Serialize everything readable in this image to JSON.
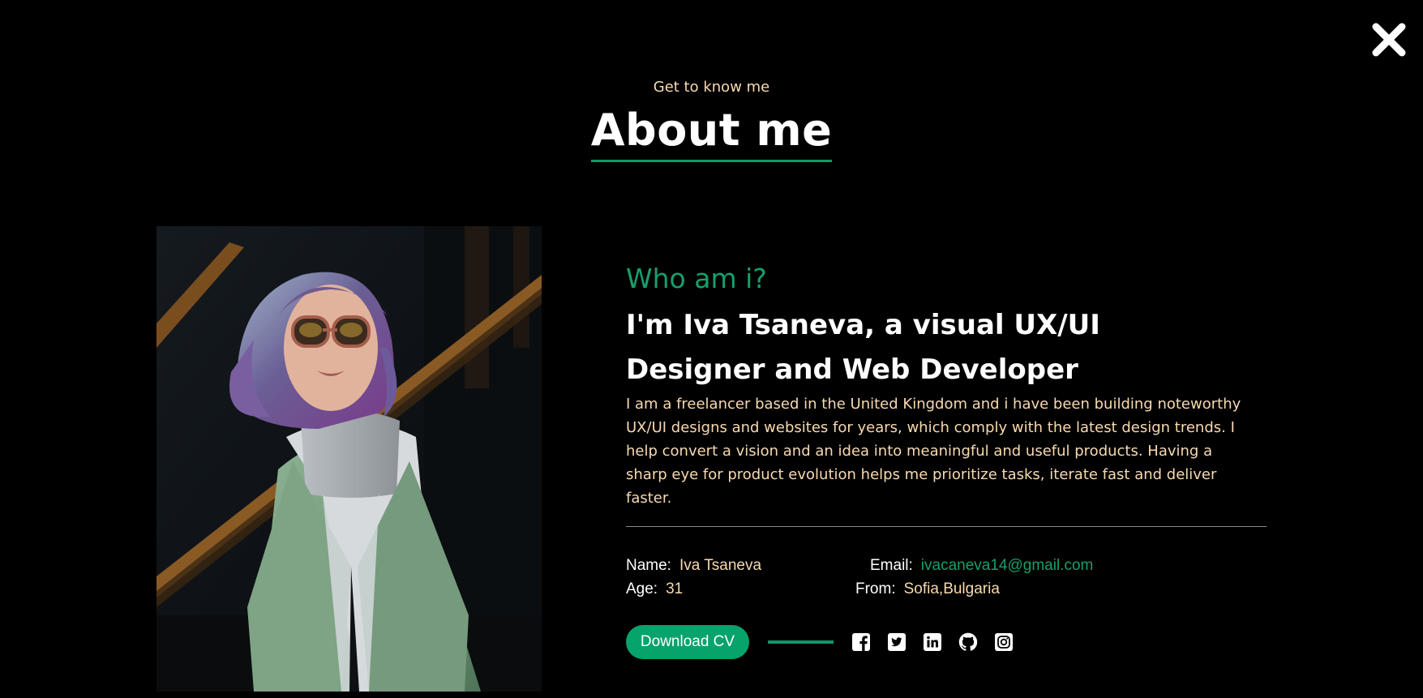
{
  "header": {
    "eyebrow": "Get to know me",
    "title": "About me"
  },
  "close": {
    "icon": "close-icon"
  },
  "profile_photo": {
    "icon": "portrait-photo"
  },
  "about": {
    "subtitle": "Who am i?",
    "headline_line1": "I'm Iva Tsaneva, a visual UX/UI",
    "headline_line2": "Designer and Web Developer",
    "bio_lines": [
      "I am a freelancer based in the United Kingdom and i have been building noteworthy",
      "UX/UI designs and websites for years, which comply with the latest design trends. I",
      "help convert a vision and an idea into meaningful and useful products. Having a",
      "sharp eye for product evolution helps me prioritize tasks, iterate fast and deliver",
      "faster."
    ]
  },
  "info": {
    "name_label": "Name:",
    "name_value": "Iva Tsaneva",
    "email_label": "Email:",
    "email_value": "ivacaneva14@gmail.com",
    "age_label": "Age:",
    "age_value": "31",
    "from_label": "From:",
    "from_value": "Sofia,Bulgaria"
  },
  "actions": {
    "download_label": "Download CV",
    "social": [
      "facebook-icon",
      "twitter-icon",
      "linkedin-icon",
      "github-icon",
      "instagram-icon"
    ]
  },
  "colors": {
    "background": "#000000",
    "accent_green": "#16a06a",
    "button_green": "#06a36b",
    "peach_text": "#f7d9b0",
    "heading_white": "#ffffff"
  }
}
